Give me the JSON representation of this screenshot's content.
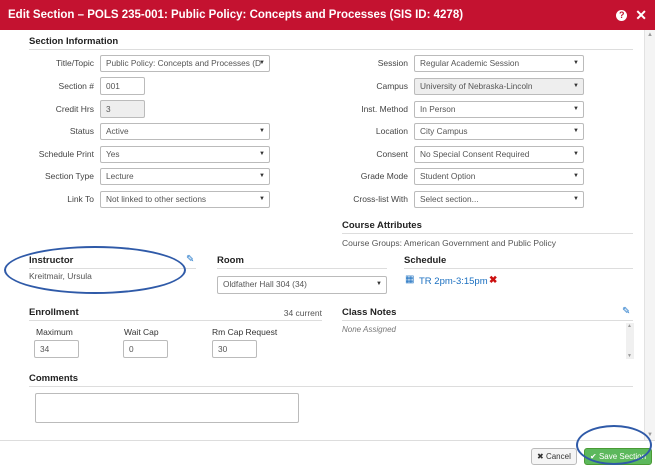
{
  "dialog": {
    "title": "Edit Section – POLS 235-001: Public Policy: Concepts and Processes (SIS ID: 4278)",
    "help_icon": "question-circle-icon",
    "close_icon": "close-icon"
  },
  "section_info": {
    "heading": "Section Information",
    "left_fields": [
      {
        "label": "Title/Topic",
        "value": "Public Policy: Concepts and Processes (D",
        "type": "select"
      },
      {
        "label": "Section #",
        "value": "001",
        "type": "input"
      },
      {
        "label": "Credit Hrs",
        "value": "3",
        "type": "input-disabled"
      },
      {
        "label": "Status",
        "value": "Active",
        "type": "select"
      },
      {
        "label": "Schedule Print",
        "value": "Yes",
        "type": "select"
      },
      {
        "label": "Section Type",
        "value": "Lecture",
        "type": "select"
      },
      {
        "label": "Link To",
        "value": "Not linked to other sections",
        "type": "select"
      }
    ],
    "right_fields": [
      {
        "label": "Session",
        "value": "Regular Academic Session",
        "type": "select"
      },
      {
        "label": "Campus",
        "value": "University of Nebraska-Lincoln",
        "type": "select-disabled"
      },
      {
        "label": "Inst. Method",
        "value": "In Person",
        "type": "select"
      },
      {
        "label": "Location",
        "value": "City Campus",
        "type": "select"
      },
      {
        "label": "Consent",
        "value": "No Special Consent Required",
        "type": "select"
      },
      {
        "label": "Grade Mode",
        "value": "Student Option",
        "type": "select"
      },
      {
        "label": "Cross-list With",
        "value": "Select section...",
        "type": "select"
      }
    ]
  },
  "course_attributes": {
    "heading": "Course Attributes",
    "text": "Course Groups: American Government and Public Policy"
  },
  "instructor": {
    "heading": "Instructor",
    "name": "Kreitmair, Ursula"
  },
  "room": {
    "heading": "Room",
    "value": "Oldfather Hall 304 (34)"
  },
  "schedule": {
    "heading": "Schedule",
    "time": "TR 2pm-3:15pm"
  },
  "enrollment": {
    "heading": "Enrollment",
    "current": "34 current",
    "maximum_label": "Maximum",
    "maximum_value": "34",
    "waitcap_label": "Wait Cap",
    "waitcap_value": "0",
    "rmcap_label": "Rm Cap Request",
    "rmcap_value": "30"
  },
  "class_notes": {
    "heading": "Class Notes",
    "text": "None Assigned"
  },
  "comments": {
    "heading": "Comments",
    "value": ""
  },
  "footer": {
    "cancel_label": "Cancel",
    "save_label": "Save Section"
  },
  "colors": {
    "title_bar": "#c41230",
    "save_button": "#5cb85c",
    "annotation": "#2f5aa8"
  }
}
